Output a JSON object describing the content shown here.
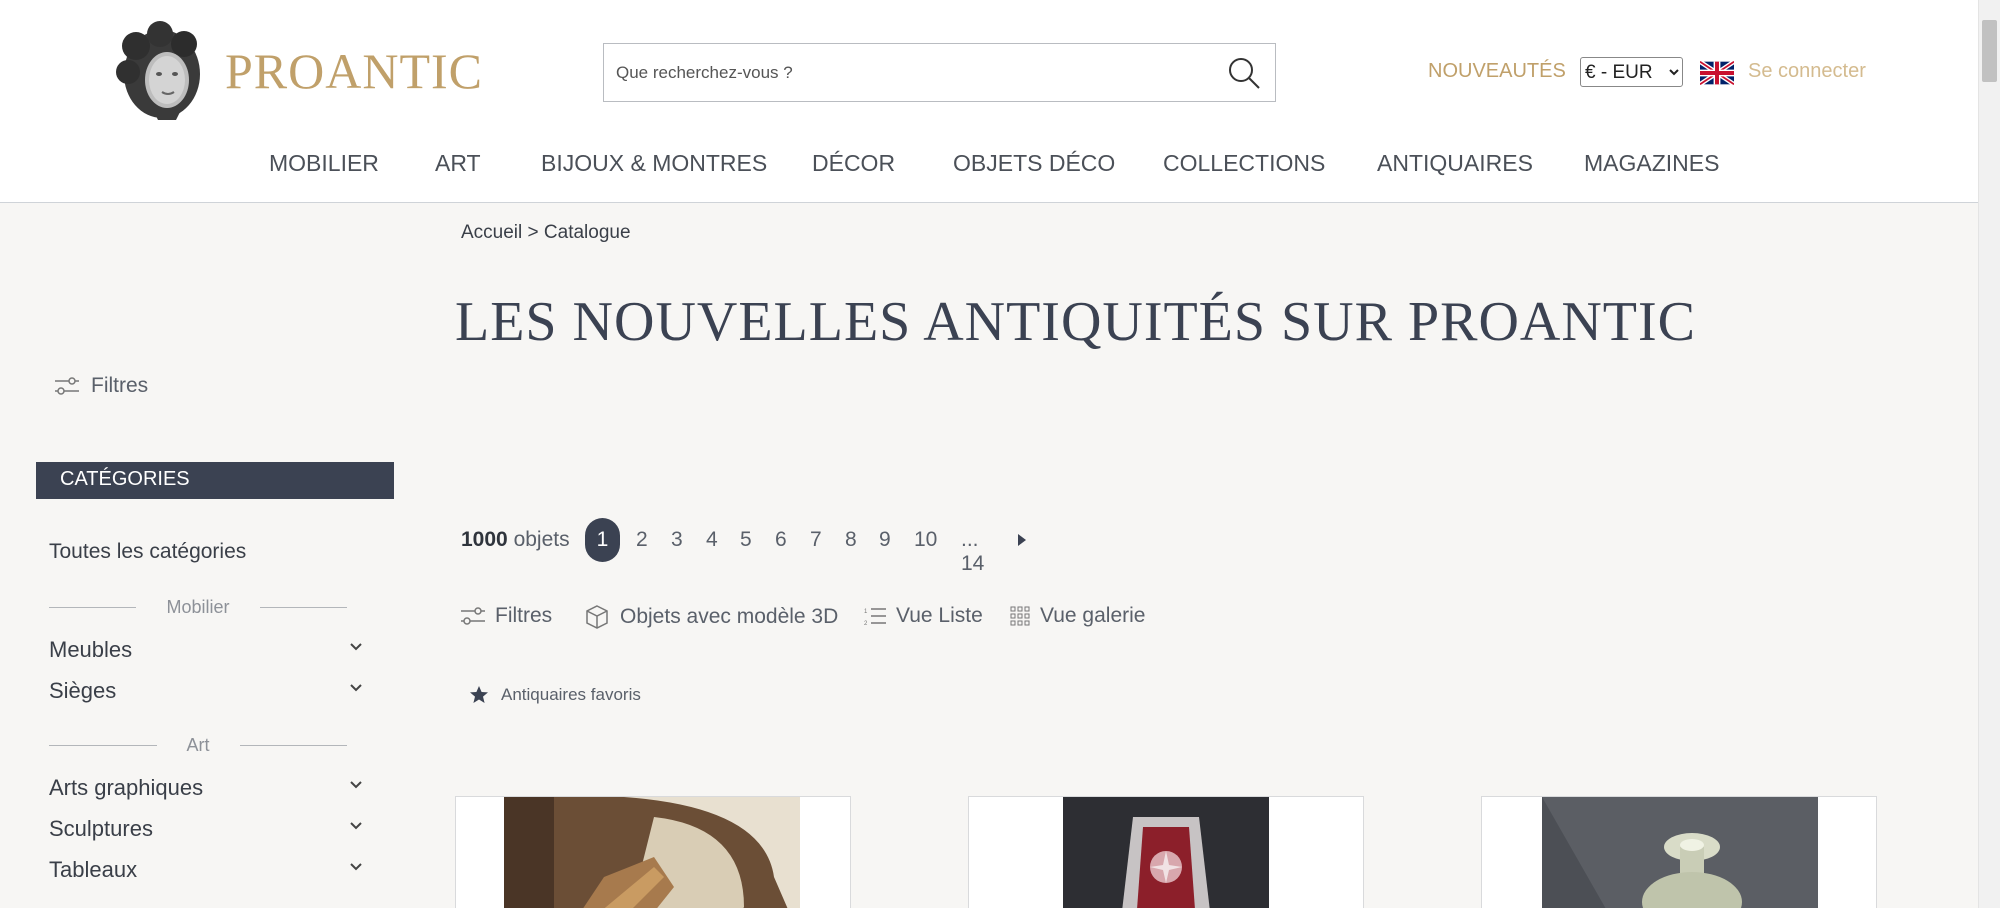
{
  "header": {
    "logo_text": "PROANTIC",
    "search_placeholder": "Que recherchez-vous ?",
    "nouveautes": "NOUVEAUTÉS",
    "currency_selected": "€ - EUR",
    "login": "Se connecter"
  },
  "nav": [
    "MOBILIER",
    "ART",
    "BIJOUX & MONTRES",
    "DÉCOR",
    "OBJETS DÉCO",
    "COLLECTIONS",
    "ANTIQUAIRES",
    "MAGAZINES"
  ],
  "sidebar": {
    "filters": "Filtres",
    "categories_header": "CATÉGORIES",
    "all_categories": "Toutes les catégories",
    "groups": [
      {
        "label": "Mobilier",
        "items": [
          "Meubles",
          "Sièges"
        ]
      },
      {
        "label": "Art",
        "items": [
          "Arts graphiques",
          "Sculptures",
          "Tableaux"
        ]
      }
    ]
  },
  "main": {
    "breadcrumb": "Accueil > Catalogue",
    "title": "LES NOUVELLES ANTIQUITÉS SUR PROANTIC",
    "count_number": "1000",
    "count_label": "objets",
    "pages": [
      "1",
      "2",
      "3",
      "4",
      "5",
      "6",
      "7",
      "8",
      "9",
      "10",
      "... 14"
    ],
    "active_page": "1",
    "toolbar": {
      "filters": "Filtres",
      "models_3d": "Objets avec modèle 3D",
      "list_view": "Vue Liste",
      "gallery_view": "Vue galerie"
    },
    "favorite_dealers": "Antiquaires favoris"
  },
  "colors": {
    "gold": "#c0a06a",
    "navy": "#3b4252",
    "background": "#f7f6f4"
  }
}
